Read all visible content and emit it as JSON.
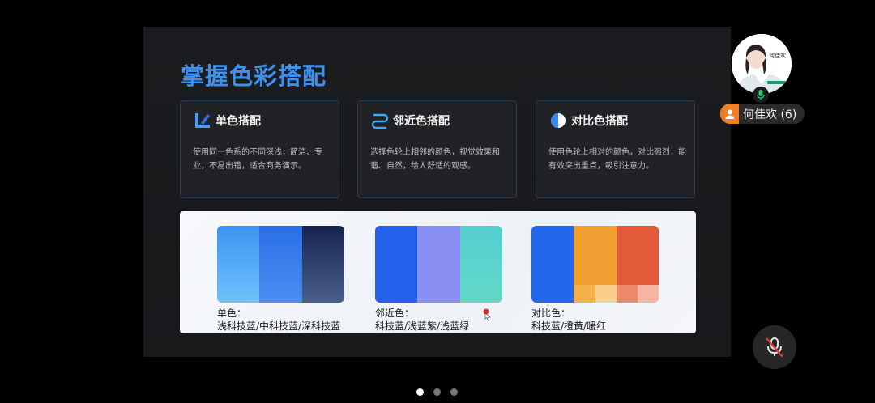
{
  "slide": {
    "title": "掌握色彩搭配",
    "cards": [
      {
        "title": "单色搭配",
        "desc": "使用同一色系的不同深浅，简洁、专业，不易出错，适合商务演示。",
        "icon": "monochrome-icon"
      },
      {
        "title": "邻近色搭配",
        "desc": "选择色轮上相邻的颜色，视觉效果和谐、自然，给人舒适的观感。",
        "icon": "analogous-icon"
      },
      {
        "title": "对比色搭配",
        "desc": "使用色轮上相对的颜色，对比强烈，能有效突出重点，吸引注意力。",
        "icon": "contrast-icon"
      }
    ],
    "palettes": [
      {
        "label_line1": "单色：",
        "label_line2": "浅科技蓝/中科技蓝/深科技蓝",
        "colors": [
          "#3d9af5",
          "#2f6fe8",
          "#1c2d5c"
        ]
      },
      {
        "label_line1": "邻近色：",
        "label_line2": "科技蓝/浅蓝紫/浅蓝绿",
        "colors": [
          "#2563eb",
          "#8a8ff0",
          "#4fd0cc"
        ]
      },
      {
        "label_line1": "对比色：",
        "label_line2": "科技蓝/橙黄/暖红",
        "colors": [
          "#2468eb",
          "#f0a030",
          "#e0583c"
        ]
      }
    ]
  },
  "participant": {
    "name_label": "何佳欢 (6)",
    "avatar_caption": "何佳欢"
  },
  "pager": {
    "count": 3,
    "active": 0
  },
  "colors": {
    "title_blue": "#3d8ff0",
    "accent_orange": "#f07f2a"
  }
}
